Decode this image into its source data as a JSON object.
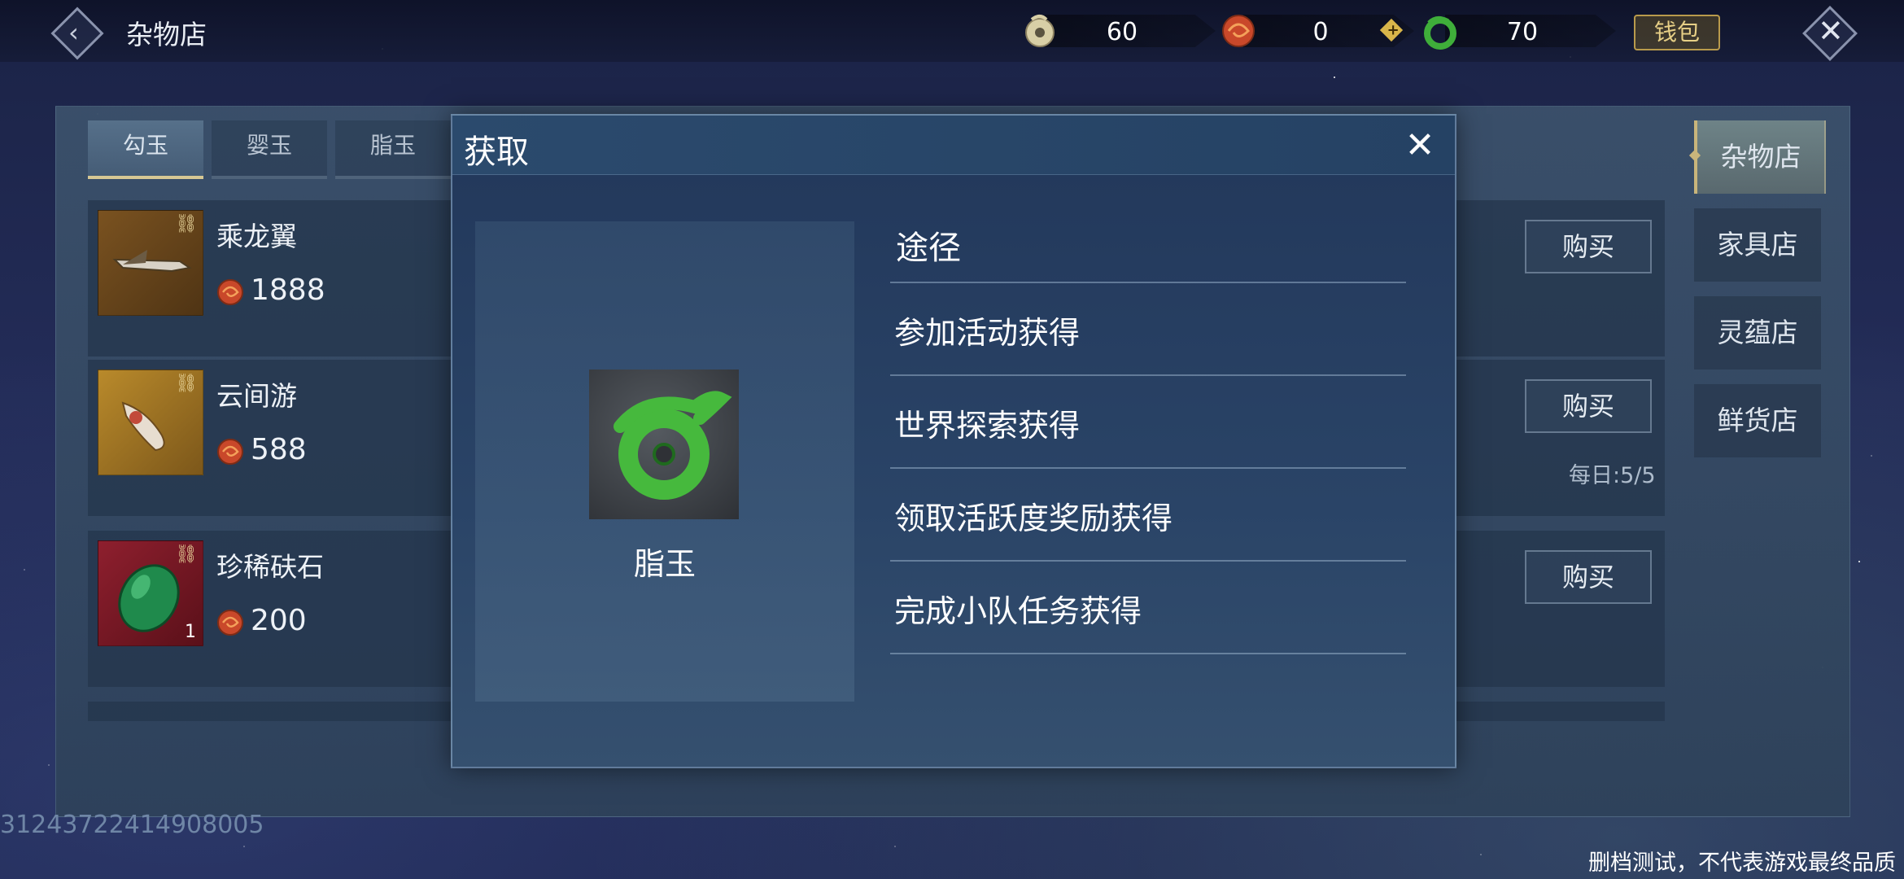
{
  "topbar": {
    "title": "杂物店",
    "resources": [
      {
        "name": "jade-coin",
        "value": "60",
        "color": "#d8cfa6"
      },
      {
        "name": "red-coin",
        "value": "0",
        "color": "#d0542a"
      },
      {
        "name": "green-jade",
        "value": "70",
        "color": "#3fae3a"
      }
    ],
    "wallet_label": "钱包"
  },
  "tabs": [
    {
      "label": "勾玉",
      "active": true
    },
    {
      "label": "婴玉",
      "active": false
    },
    {
      "label": "脂玉",
      "active": false
    }
  ],
  "items": [
    {
      "name": "乘龙翼",
      "price": "1888",
      "qty": "",
      "buy": "购买",
      "daily": ""
    },
    {
      "name": "云间游",
      "price": "588",
      "qty": "",
      "buy": "购买",
      "daily": "每日:5/5"
    },
    {
      "name": "珍稀砆石",
      "price": "200",
      "qty": "1",
      "buy": "购买",
      "daily": ""
    }
  ],
  "nav": [
    {
      "label": "杂物店",
      "active": true
    },
    {
      "label": "家具店",
      "active": false
    },
    {
      "label": "灵蕴店",
      "active": false
    },
    {
      "label": "鲜货店",
      "active": false
    }
  ],
  "dialog": {
    "title": "获取",
    "item_name": "脂玉",
    "routes_header": "途径",
    "routes": [
      "参加活动获得",
      "世界探索获得",
      "领取活跃度奖励获得",
      "完成小队任务获得"
    ]
  },
  "footer": {
    "uid": "3124372241490800​5",
    "disclaimer": "删档测试，不代表游戏最终品质"
  },
  "colors": {
    "accent_gold": "#d7c894",
    "panel": "#3c526c"
  }
}
